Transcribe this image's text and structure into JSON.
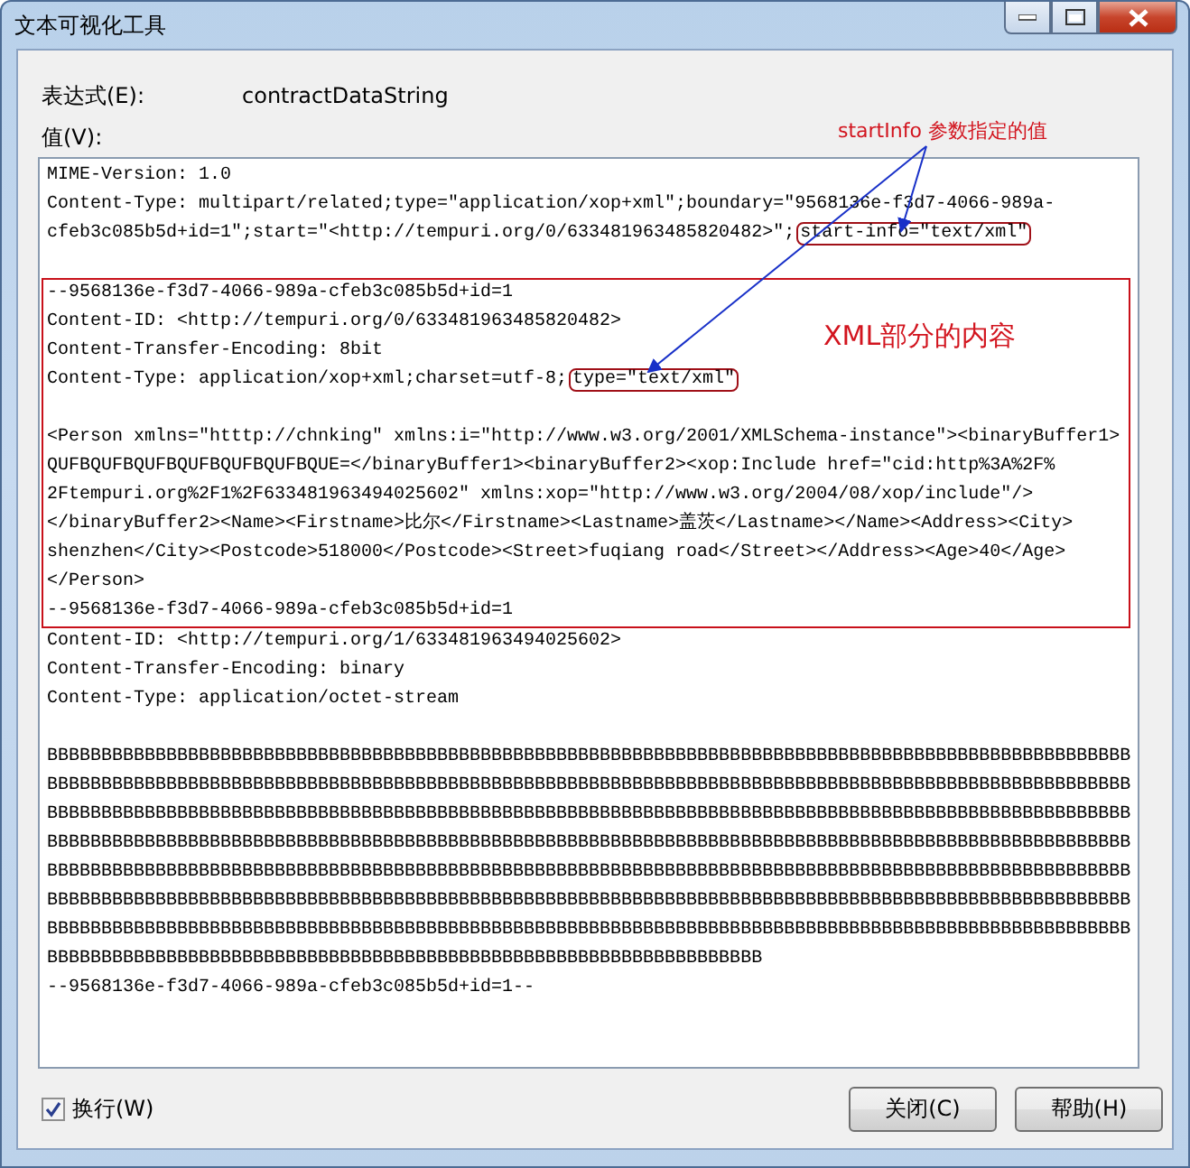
{
  "window": {
    "title": "文本可视化工具"
  },
  "expression": {
    "label": "表达式(E):",
    "value": "contractDataString"
  },
  "value_label": "值(V):",
  "sections": [
    {
      "highlighted": false,
      "lines": [
        {
          "kind": "text",
          "text": "MIME-Version: 1.0"
        },
        {
          "kind": "text",
          "text": "Content-Type: multipart/related;type=\"application/xop+xml\";boundary=\"9568136e-f3d7-4066-989a-"
        },
        {
          "kind": "text",
          "text": "cfeb3c085b5d+id=1\";start=\"<http://tempuri.org/0/633481963485820482>\";",
          "boxed": "start-info=\"text/xml\""
        },
        {
          "kind": "blank"
        }
      ]
    },
    {
      "highlighted": true,
      "lines": [
        {
          "kind": "text",
          "text": "--9568136e-f3d7-4066-989a-cfeb3c085b5d+id=1"
        },
        {
          "kind": "text",
          "text": "Content-ID: <http://tempuri.org/0/633481963485820482>"
        },
        {
          "kind": "text",
          "text": "Content-Transfer-Encoding: 8bit"
        },
        {
          "kind": "text",
          "text": "Content-Type: application/xop+xml;charset=utf-8;",
          "boxed": "type=\"text/xml\""
        },
        {
          "kind": "blank"
        },
        {
          "kind": "text",
          "text": "<Person xmlns=\"htttp://chnking\" xmlns:i=\"http://www.w3.org/2001/XMLSchema-instance\"><binaryBuffer1>"
        },
        {
          "kind": "text",
          "text": "QUFBQUFBQUFBQUFBQUFBQUFBQUE=</binaryBuffer1><binaryBuffer2><xop:Include href=\"cid:http%3A%2F%"
        },
        {
          "kind": "text",
          "text": "2Ftempuri.org%2F1%2F633481963494025602\" xmlns:xop=\"http://www.w3.org/2004/08/xop/include\"/>"
        },
        {
          "kind": "text",
          "text": "</binaryBuffer2><Name><Firstname>比尔</Firstname><Lastname>盖茨</Lastname></Name><Address><City>"
        },
        {
          "kind": "text",
          "text": "shenzhen</City><Postcode>518000</Postcode><Street>fuqiang road</Street></Address><Age>40</Age>"
        },
        {
          "kind": "text",
          "text": "</Person>"
        },
        {
          "kind": "text",
          "text": "--9568136e-f3d7-4066-989a-cfeb3c085b5d+id=1"
        }
      ]
    },
    {
      "highlighted": false,
      "lines": [
        {
          "kind": "text",
          "text": "Content-ID: <http://tempuri.org/1/633481963494025602>"
        },
        {
          "kind": "text",
          "text": "Content-Transfer-Encoding: binary"
        },
        {
          "kind": "text",
          "text": "Content-Type: application/octet-stream"
        },
        {
          "kind": "blank"
        },
        {
          "kind": "text",
          "text": "BBBBBBBBBBBBBBBBBBBBBBBBBBBBBBBBBBBBBBBBBBBBBBBBBBBBBBBBBBBBBBBBBBBBBBBBBBBBBBBBBBBBBBBBBBBBBBBBBBBB"
        },
        {
          "kind": "text",
          "text": "BBBBBBBBBBBBBBBBBBBBBBBBBBBBBBBBBBBBBBBBBBBBBBBBBBBBBBBBBBBBBBBBBBBBBBBBBBBBBBBBBBBBBBBBBBBBBBBBBBBB"
        },
        {
          "kind": "text",
          "text": "BBBBBBBBBBBBBBBBBBBBBBBBBBBBBBBBBBBBBBBBBBBBBBBBBBBBBBBBBBBBBBBBBBBBBBBBBBBBBBBBBBBBBBBBBBBBBBBBBBBB"
        },
        {
          "kind": "text",
          "text": "BBBBBBBBBBBBBBBBBBBBBBBBBBBBBBBBBBBBBBBBBBBBBBBBBBBBBBBBBBBBBBBBBBBBBBBBBBBBBBBBBBBBBBBBBBBBBBBBBBBB"
        },
        {
          "kind": "text",
          "text": "BBBBBBBBBBBBBBBBBBBBBBBBBBBBBBBBBBBBBBBBBBBBBBBBBBBBBBBBBBBBBBBBBBBBBBBBBBBBBBBBBBBBBBBBBBBBBBBBBBBB"
        },
        {
          "kind": "text",
          "text": "BBBBBBBBBBBBBBBBBBBBBBBBBBBBBBBBBBBBBBBBBBBBBBBBBBBBBBBBBBBBBBBBBBBBBBBBBBBBBBBBBBBBBBBBBBBBBBBBBBBB"
        },
        {
          "kind": "text",
          "text": "BBBBBBBBBBBBBBBBBBBBBBBBBBBBBBBBBBBBBBBBBBBBBBBBBBBBBBBBBBBBBBBBBBBBBBBBBBBBBBBBBBBBBBBBBBBBBBBBBBBB"
        },
        {
          "kind": "text",
          "text": "BBBBBBBBBBBBBBBBBBBBBBBBBBBBBBBBBBBBBBBBBBBBBBBBBBBBBBBBBBBBBBBBBB"
        },
        {
          "kind": "text",
          "text": "--9568136e-f3d7-4066-989a-cfeb3c085b5d+id=1--"
        }
      ]
    }
  ],
  "annotations": [
    {
      "kind": "callout",
      "text": "startInfo 参数指定的值"
    },
    {
      "kind": "section-label",
      "text": "XML部分的内容"
    }
  ],
  "wrap": {
    "label": "换行(W)",
    "checked": true
  },
  "buttons": [
    {
      "label": "关闭(C)"
    },
    {
      "label": "帮助(H)"
    }
  ]
}
